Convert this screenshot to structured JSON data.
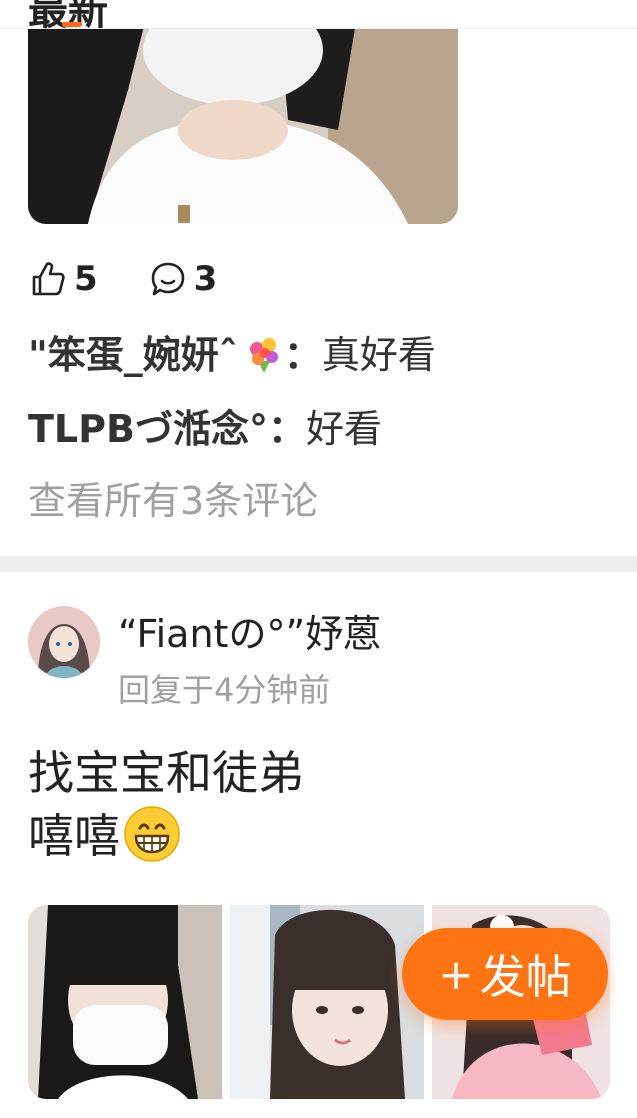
{
  "header": {
    "section_title": "最新"
  },
  "post1": {
    "like_count": "5",
    "comment_count": "3",
    "comments": [
      {
        "author": "\"笨蛋_婉妍ˆ",
        "separator": "：",
        "text": "真好看"
      },
      {
        "author": "TLPBづ湉念°",
        "separator": "：",
        "text": "好看"
      }
    ],
    "view_all_label": "查看所有3条评论"
  },
  "post2": {
    "username": "“Fiantの°”妤蒽",
    "reply_time": "回复于4分钟前",
    "body_lines": [
      "找宝宝和徒弟",
      "嘻嘻"
    ]
  },
  "fab": {
    "plus": "+",
    "label": "发帖",
    "color": "#ff7412"
  },
  "icons": {
    "like": "thumbs-up-icon",
    "comment": "comment-bubble-icon",
    "flower": "bouquet-emoji",
    "grin": "grinning-face-emoji"
  },
  "colors": {
    "accent": "#ff6a1a",
    "muted_text": "#a0a0a0",
    "divider": "#eeeeee"
  }
}
